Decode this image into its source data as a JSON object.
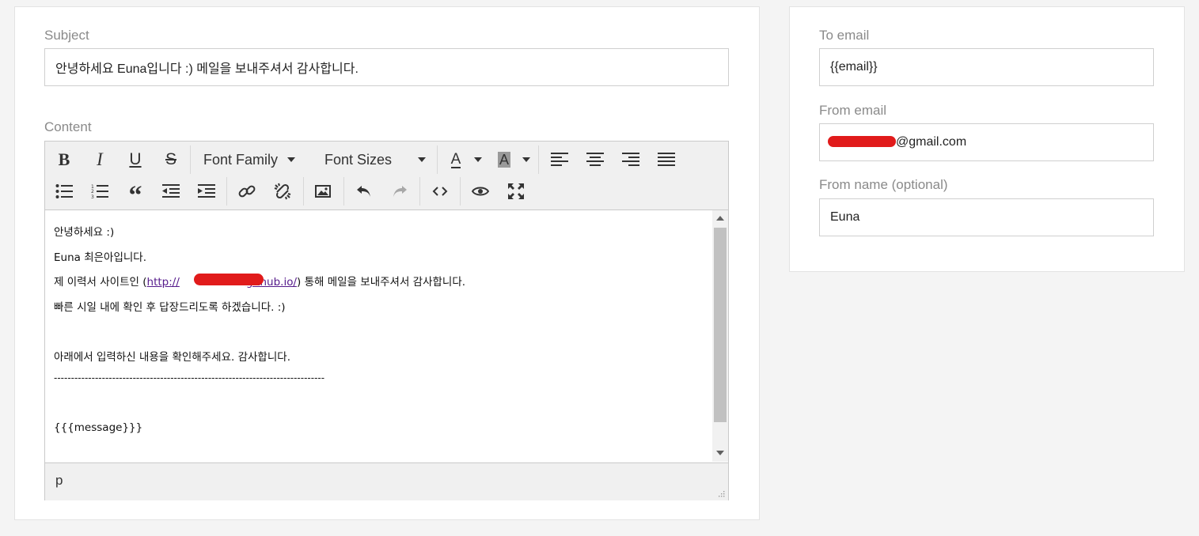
{
  "subject": {
    "label": "Subject",
    "value": "안녕하세요 Euna입니다 :) 메일을 보내주셔서 감사합니다."
  },
  "content": {
    "label": "Content",
    "toolbar": {
      "font_family": "Font Family",
      "font_sizes": "Font Sizes",
      "text_color_glyph": "A",
      "bg_color_glyph": "A"
    },
    "lines": [
      "안녕하세요 :)",
      "Euna 최은아입니다.",
      "빠른 시일 내에 확인 후 답장드리도록 하겠습니다. :)",
      "아래에서 입력하신 내용을 확인해주세요. 감사합니다.",
      "-------------------------------------------------------------------------------",
      "{{{message}}}"
    ],
    "link_line": {
      "prefix": "제 이력서 사이트인 (",
      "link_start": "http://",
      "link_end": "github.io/",
      "suffix": ") 통해 메일을 보내주셔서 감사합니다."
    },
    "status_path": "p"
  },
  "right": {
    "to_email": {
      "label": "To email",
      "value": "{{email}}"
    },
    "from_email": {
      "label": "From email",
      "value": "@gmail.com"
    },
    "from_name": {
      "label": "From name (optional)",
      "value": "Euna"
    }
  },
  "colors": {
    "redaction": "#e11b1b",
    "link": "#551a8b",
    "label": "#8a8a8a"
  }
}
